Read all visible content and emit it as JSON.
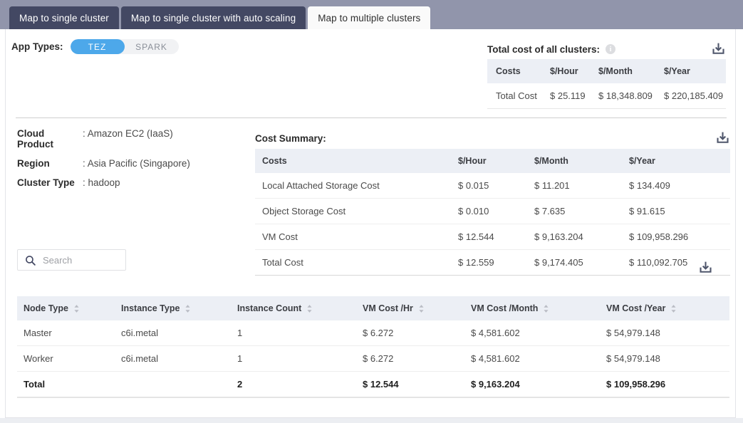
{
  "tabs": [
    {
      "label": "Map to single cluster",
      "active": false
    },
    {
      "label": "Map to single cluster with auto scaling",
      "active": false
    },
    {
      "label": "Map to multiple clusters",
      "active": true
    }
  ],
  "app_types": {
    "label": "App Types:",
    "options": [
      {
        "label": "TEZ",
        "selected": true
      },
      {
        "label": "SPARK",
        "selected": false
      }
    ],
    "selected_color": "#4da8ea"
  },
  "total_cost_block": {
    "title": "Total cost of all clusters:",
    "info_icon": "info-icon",
    "download_icon": "download-icon",
    "columns": [
      "Costs",
      "$/Hour",
      "$/Month",
      "$/Year"
    ],
    "rows": [
      [
        "Total Cost",
        "$ 25.119",
        "$ 18,348.809",
        "$ 220,185.409"
      ]
    ]
  },
  "meta": [
    {
      "key": "Cloud Product",
      "value": ": Amazon EC2 (IaaS)"
    },
    {
      "key": "Region",
      "value": ": Asia Pacific (Singapore)"
    },
    {
      "key": "Cluster Type",
      "value": ": hadoop"
    }
  ],
  "cost_summary": {
    "title": "Cost Summary:",
    "download_icon": "download-icon",
    "columns": [
      "Costs",
      "$/Hour",
      "$/Month",
      "$/Year"
    ],
    "rows": [
      [
        "Local Attached Storage Cost",
        "$ 0.015",
        "$ 11.201",
        "$ 134.409"
      ],
      [
        "Object Storage Cost",
        "$ 0.010",
        "$ 7.635",
        "$ 91.615"
      ],
      [
        "VM Cost",
        "$ 12.544",
        "$ 9,163.204",
        "$ 109,958.296"
      ],
      [
        "Total Cost",
        "$ 12.559",
        "$ 9,174.405",
        "$ 110,092.705"
      ]
    ]
  },
  "search": {
    "placeholder": "Search",
    "value": "",
    "icon": "search-icon"
  },
  "node_table": {
    "download_icon": "download-icon",
    "columns": [
      "Node Type",
      "Instance Type",
      "Instance Count",
      "VM Cost /Hr",
      "VM Cost /Month",
      "VM Cost /Year"
    ],
    "rows": [
      [
        "Master",
        "c6i.metal",
        "1",
        "$ 6.272",
        "$ 4,581.602",
        "$ 54,979.148"
      ],
      [
        "Worker",
        "c6i.metal",
        "1",
        "$ 6.272",
        "$ 4,581.602",
        "$ 54,979.148"
      ]
    ],
    "total_row": [
      "Total",
      "",
      "2",
      "$ 12.544",
      "$ 9,163.204",
      "$ 109,958.296"
    ]
  }
}
